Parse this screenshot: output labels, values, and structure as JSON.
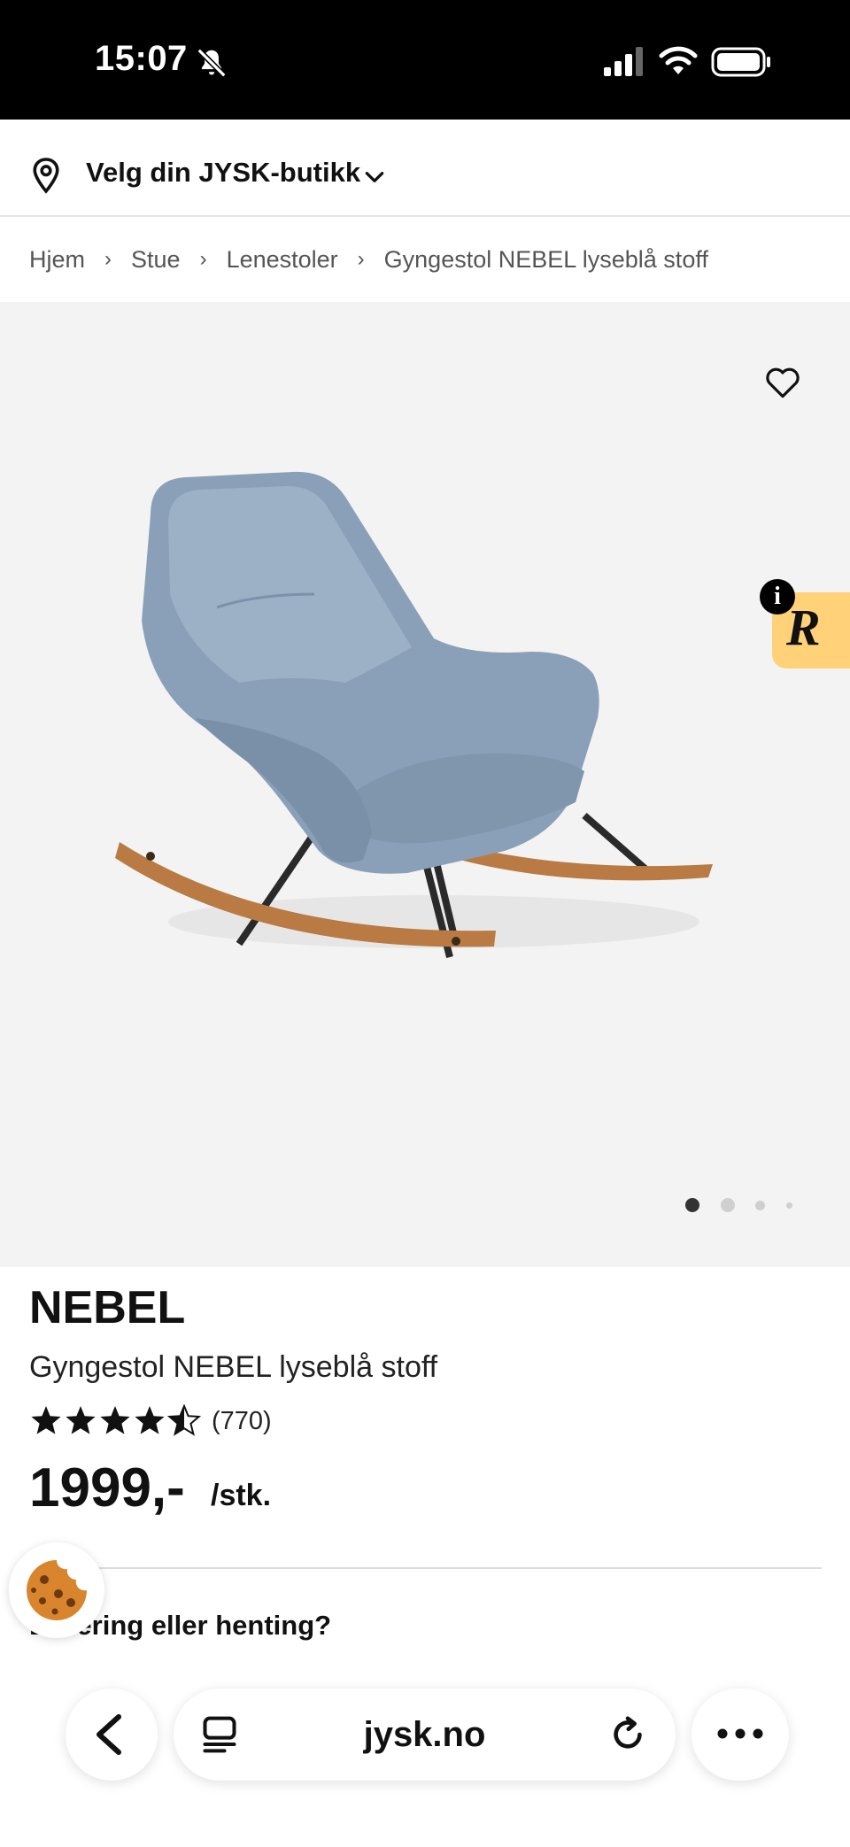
{
  "status_bar": {
    "time": "15:07",
    "icons": [
      "bell-slash-icon",
      "cellular-signal-icon",
      "wifi-icon",
      "battery-icon"
    ]
  },
  "store_selector": {
    "label": "Velg din JYSK-butikk",
    "icon": "map-pin-icon"
  },
  "breadcrumb": {
    "items": [
      "Hjem",
      "Stue",
      "Lenestoler",
      "Gyngestol NEBEL lyseblå stoff"
    ]
  },
  "gallery": {
    "badge_letter": "R",
    "badge_info": "i",
    "badge_color": "#ffd27a",
    "current_image": 1,
    "image_count": 4
  },
  "product": {
    "brand": "NEBEL",
    "name": "Gyngestol NEBEL lyseblå stoff",
    "rating": 4.5,
    "rating_max": 5,
    "review_count": "(770)",
    "price": "1999,-",
    "unit": "/stk."
  },
  "delivery": {
    "heading": "Levering eller henting?",
    "visible_text": "ering eller henting?"
  },
  "browser": {
    "url": "jysk.no"
  },
  "colors": {
    "chair_fabric": "#8aa0b8",
    "wood": "#b97a44",
    "gallery_bg": "#f3f3f3"
  }
}
